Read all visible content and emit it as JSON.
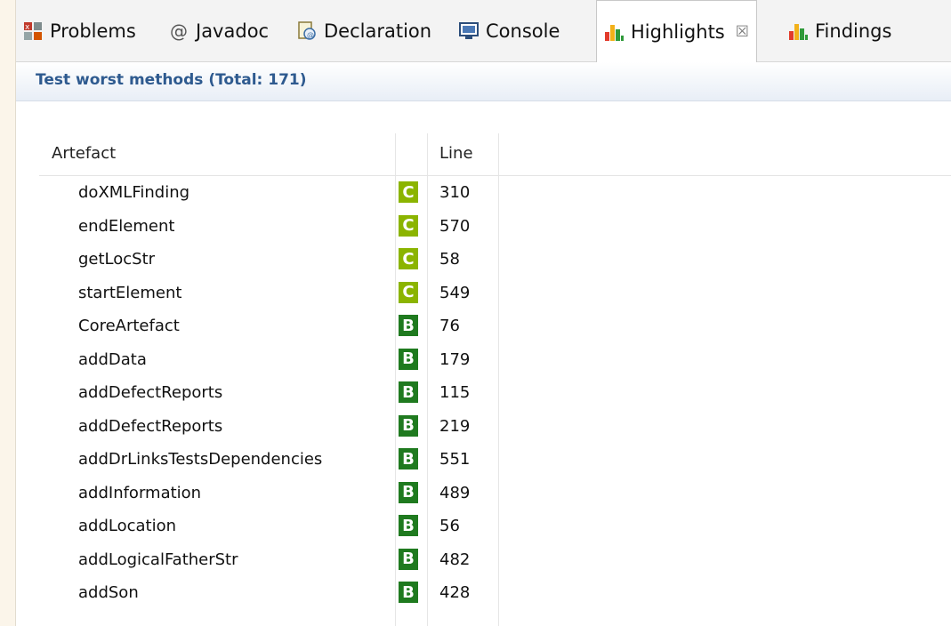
{
  "tabs": [
    {
      "label": "Problems",
      "icon": "problems-icon"
    },
    {
      "label": "Javadoc",
      "icon": "at-sign-icon"
    },
    {
      "label": "Declaration",
      "icon": "declaration-icon"
    },
    {
      "label": "Console",
      "icon": "console-icon"
    },
    {
      "label": "Highlights",
      "icon": "bar-chart-icon",
      "active": true,
      "close_glyph": "☒"
    },
    {
      "label": "Findings",
      "icon": "bar-chart-icon"
    }
  ],
  "header": {
    "title": "Test worst methods (Total: 171)"
  },
  "table": {
    "columns": [
      "Artefact",
      "",
      "Line"
    ],
    "rows": [
      {
        "name": "doXMLFinding",
        "grade": "C",
        "line": "310"
      },
      {
        "name": "endElement",
        "grade": "C",
        "line": "570"
      },
      {
        "name": "getLocStr",
        "grade": "C",
        "line": "58"
      },
      {
        "name": "startElement",
        "grade": "C",
        "line": "549"
      },
      {
        "name": "CoreArtefact",
        "grade": "B",
        "line": "76"
      },
      {
        "name": "addData",
        "grade": "B",
        "line": "179"
      },
      {
        "name": "addDefectReports",
        "grade": "B",
        "line": "115"
      },
      {
        "name": "addDefectReports",
        "grade": "B",
        "line": "219"
      },
      {
        "name": "addDrLinksTestsDependencies",
        "grade": "B",
        "line": "551"
      },
      {
        "name": "addInformation",
        "grade": "B",
        "line": "489"
      },
      {
        "name": "addLocation",
        "grade": "B",
        "line": "56"
      },
      {
        "name": "addLogicalFatherStr",
        "grade": "B",
        "line": "482"
      },
      {
        "name": "addSon",
        "grade": "B",
        "line": "428"
      }
    ]
  },
  "colors": {
    "grade_C": "#8bb400",
    "grade_B": "#1f7a1f",
    "header_text": "#2e5a8f"
  }
}
